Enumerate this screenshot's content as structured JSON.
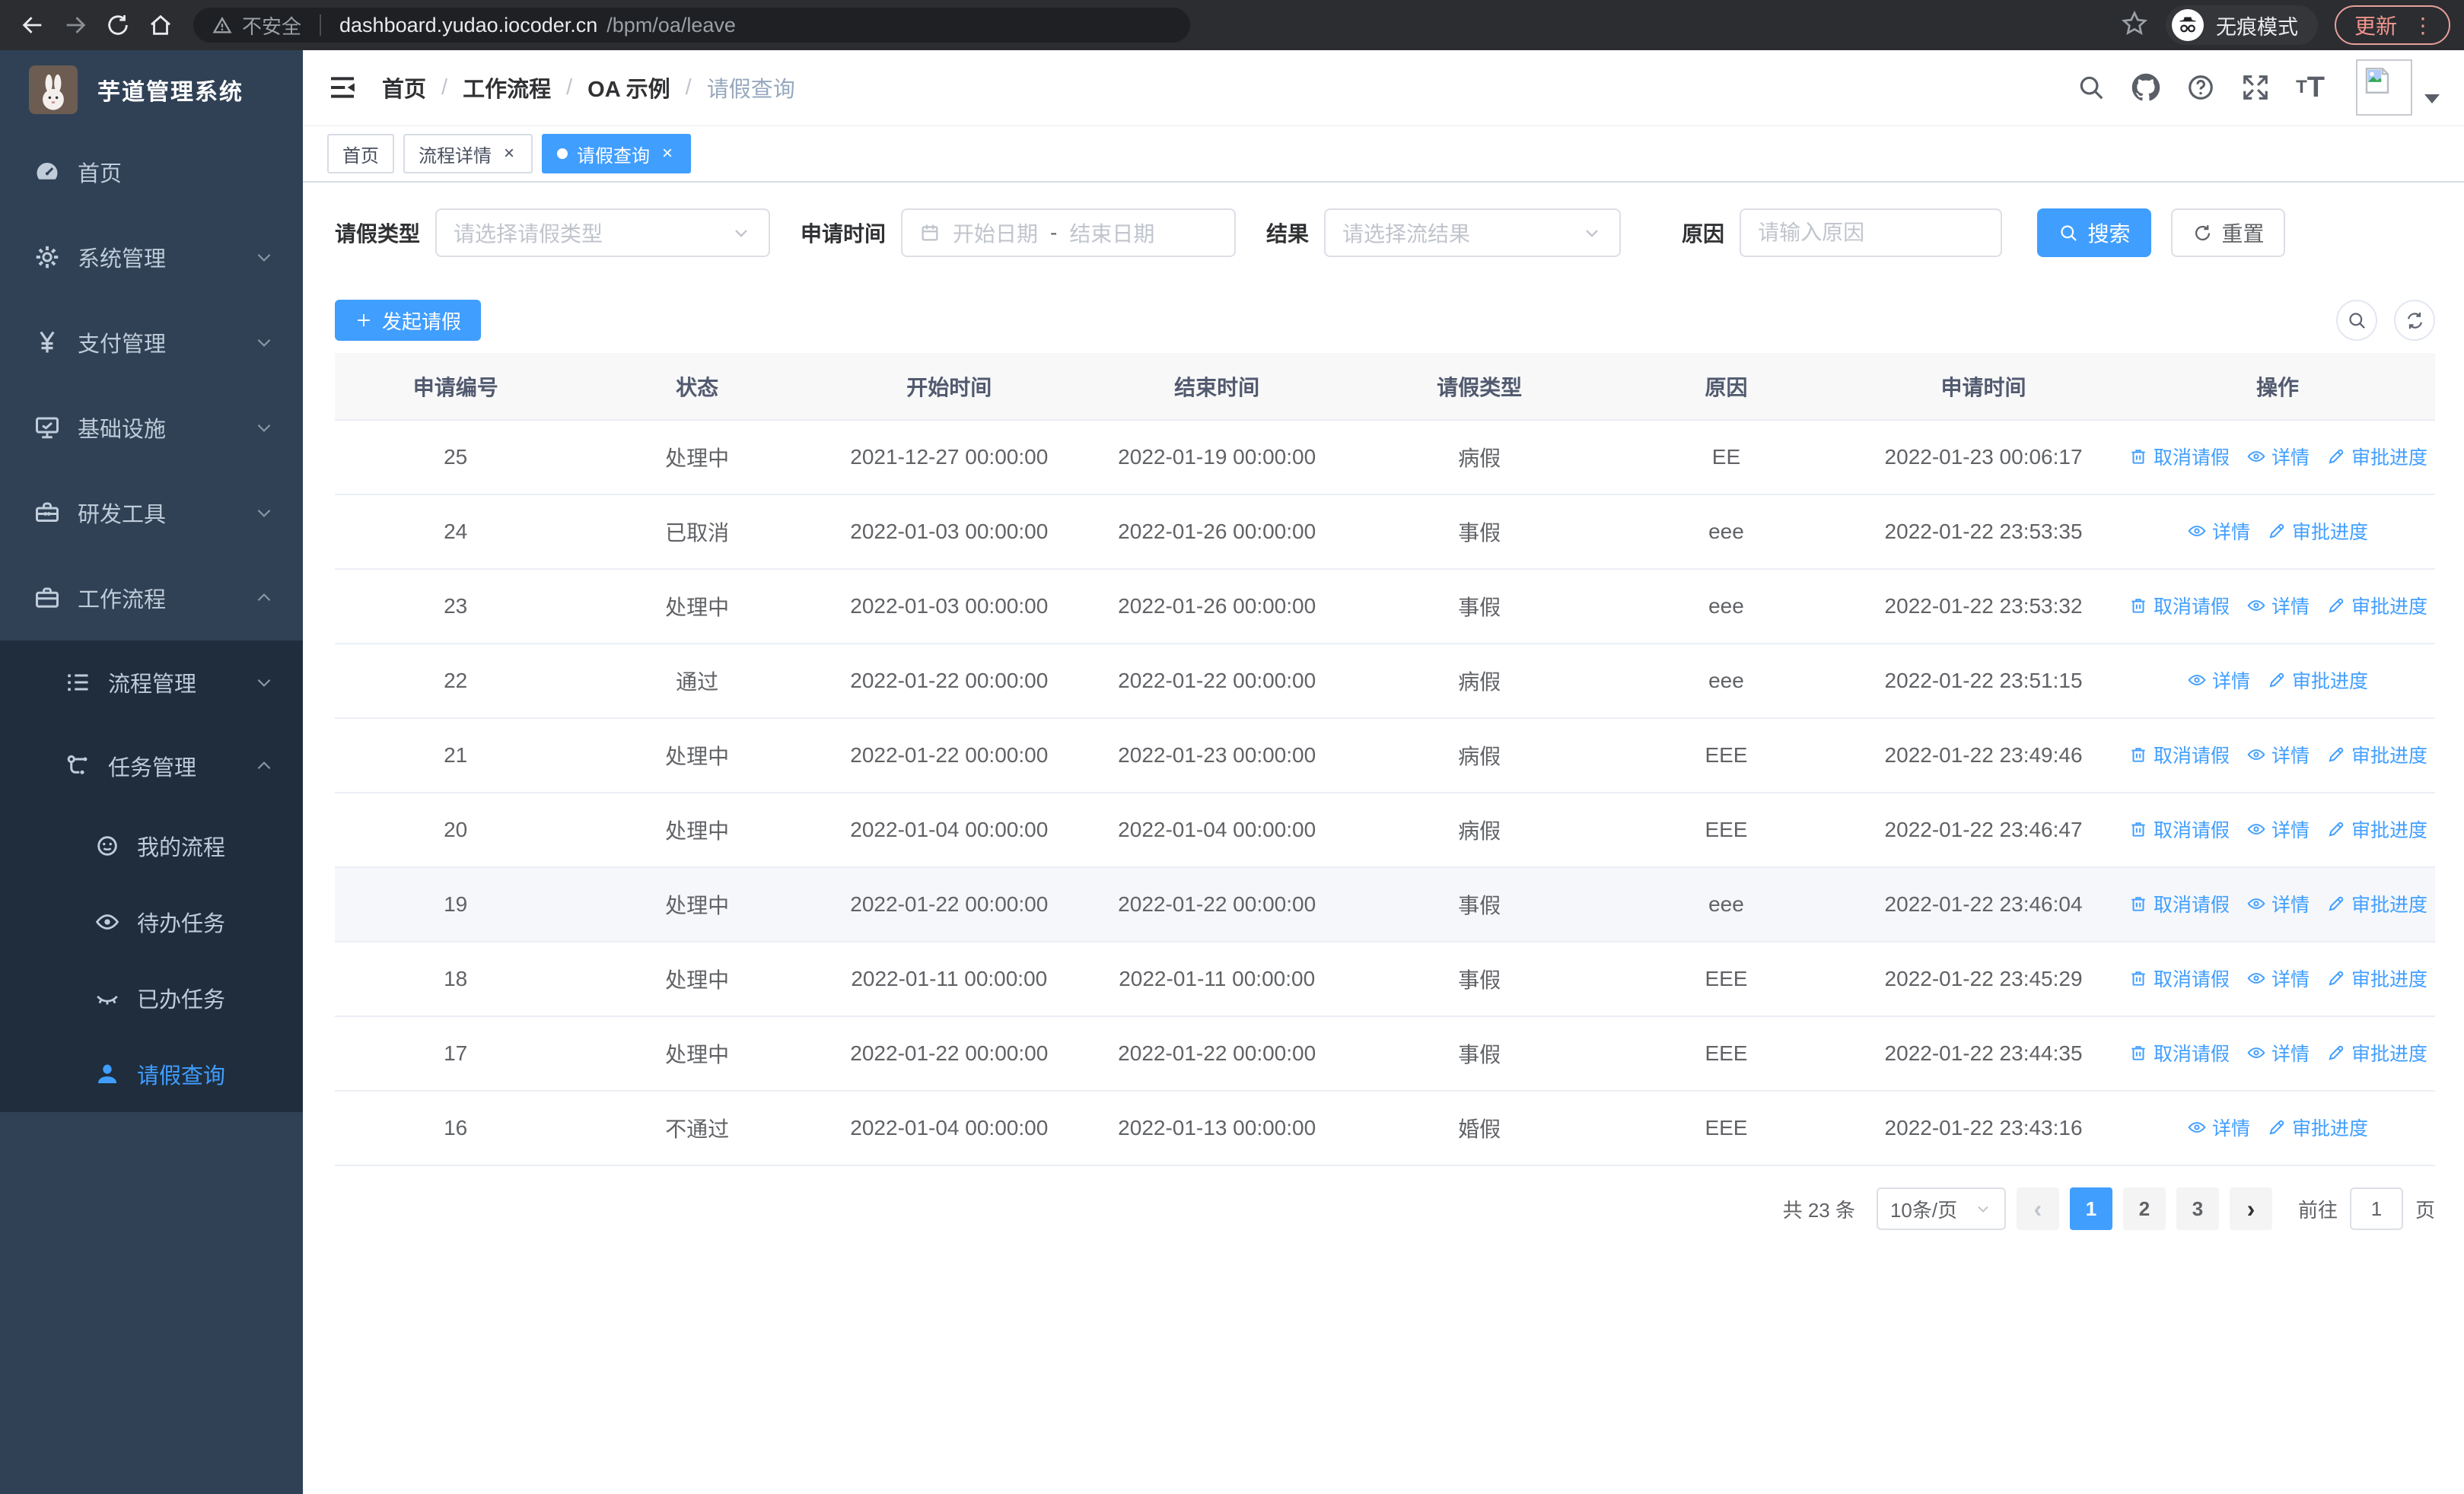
{
  "browser": {
    "security_text": "不安全",
    "url_host": "dashboard.yudao.iocoder.cn",
    "url_path": "/bpm/oa/leave",
    "incognito_label": "无痕模式",
    "update_label": "更新",
    "accent_color": "#f0958c"
  },
  "sidebar": {
    "title": "芋道管理系统",
    "menu": [
      {
        "key": "home",
        "label": "首页",
        "icon": "dashboard-icon",
        "expandable": false,
        "expanded": false
      },
      {
        "key": "system",
        "label": "系统管理",
        "icon": "gear-icon",
        "expandable": true,
        "expanded": false
      },
      {
        "key": "payment",
        "label": "支付管理",
        "icon": "yen-icon",
        "expandable": true,
        "expanded": false
      },
      {
        "key": "infra",
        "label": "基础设施",
        "icon": "monitor-icon",
        "expandable": true,
        "expanded": false
      },
      {
        "key": "dev-tools",
        "label": "研发工具",
        "icon": "toolbox-icon",
        "expandable": true,
        "expanded": false
      },
      {
        "key": "workflow",
        "label": "工作流程",
        "icon": "briefcase-icon",
        "expandable": true,
        "expanded": true
      }
    ],
    "submenu": [
      {
        "key": "process-mgmt",
        "label": "流程管理",
        "icon": "list-icon",
        "expandable": true,
        "expanded": false,
        "children": []
      },
      {
        "key": "task-mgmt",
        "label": "任务管理",
        "icon": "flow-icon",
        "expandable": true,
        "expanded": true,
        "children": [
          {
            "key": "my-process",
            "label": "我的流程",
            "icon": "face-icon",
            "active": false
          },
          {
            "key": "todo-tasks",
            "label": "待办任务",
            "icon": "eye-icon",
            "active": false
          },
          {
            "key": "done-tasks",
            "label": "已办任务",
            "icon": "eye-closed-icon",
            "active": false
          },
          {
            "key": "leave-query",
            "label": "请假查询",
            "icon": "user-icon",
            "active": true
          }
        ]
      }
    ],
    "colors": {
      "bg": "#304156",
      "submenu_bg": "#1f2d3d",
      "text": "#bfcbd9",
      "active": "#409eff"
    }
  },
  "navbar": {
    "breadcrumb": [
      "首页",
      "工作流程",
      "OA 示例",
      "请假查询"
    ]
  },
  "tags": [
    {
      "label": "首页",
      "closable": false,
      "active": false
    },
    {
      "label": "流程详情",
      "closable": true,
      "active": false
    },
    {
      "label": "请假查询",
      "closable": true,
      "active": true
    }
  ],
  "filters": {
    "leave_type_label": "请假类型",
    "leave_type_placeholder": "请选择请假类型",
    "apply_time_label": "申请时间",
    "date_start_placeholder": "开始日期",
    "date_separator": "-",
    "date_end_placeholder": "结束日期",
    "result_label": "结果",
    "result_placeholder": "请选择流结果",
    "reason_label": "原因",
    "reason_placeholder": "请输入原因",
    "search_label": "搜索",
    "reset_label": "重置"
  },
  "toolbar": {
    "create_label": "发起请假"
  },
  "table": {
    "columns": [
      "申请编号",
      "状态",
      "开始时间",
      "结束时间",
      "请假类型",
      "原因",
      "申请时间",
      "操作"
    ],
    "action_labels": {
      "cancel": "取消请假",
      "detail": "详情",
      "progress": "审批进度"
    },
    "rows": [
      {
        "id": "25",
        "status": "处理中",
        "start": "2021-12-27 00:00:00",
        "end": "2022-01-19 00:00:00",
        "type": "病假",
        "reason": "EE",
        "applied": "2022-01-23 00:06:17",
        "actions": [
          "cancel",
          "detail",
          "progress"
        ],
        "highlight": false
      },
      {
        "id": "24",
        "status": "已取消",
        "start": "2022-01-03 00:00:00",
        "end": "2022-01-26 00:00:00",
        "type": "事假",
        "reason": "eee",
        "applied": "2022-01-22 23:53:35",
        "actions": [
          "detail",
          "progress"
        ],
        "highlight": false
      },
      {
        "id": "23",
        "status": "处理中",
        "start": "2022-01-03 00:00:00",
        "end": "2022-01-26 00:00:00",
        "type": "事假",
        "reason": "eee",
        "applied": "2022-01-22 23:53:32",
        "actions": [
          "cancel",
          "detail",
          "progress"
        ],
        "highlight": false
      },
      {
        "id": "22",
        "status": "通过",
        "start": "2022-01-22 00:00:00",
        "end": "2022-01-22 00:00:00",
        "type": "病假",
        "reason": "eee",
        "applied": "2022-01-22 23:51:15",
        "actions": [
          "detail",
          "progress"
        ],
        "highlight": false
      },
      {
        "id": "21",
        "status": "处理中",
        "start": "2022-01-22 00:00:00",
        "end": "2022-01-23 00:00:00",
        "type": "病假",
        "reason": "EEE",
        "applied": "2022-01-22 23:49:46",
        "actions": [
          "cancel",
          "detail",
          "progress"
        ],
        "highlight": false
      },
      {
        "id": "20",
        "status": "处理中",
        "start": "2022-01-04 00:00:00",
        "end": "2022-01-04 00:00:00",
        "type": "病假",
        "reason": "EEE",
        "applied": "2022-01-22 23:46:47",
        "actions": [
          "cancel",
          "detail",
          "progress"
        ],
        "highlight": false
      },
      {
        "id": "19",
        "status": "处理中",
        "start": "2022-01-22 00:00:00",
        "end": "2022-01-22 00:00:00",
        "type": "事假",
        "reason": "eee",
        "applied": "2022-01-22 23:46:04",
        "actions": [
          "cancel",
          "detail",
          "progress"
        ],
        "highlight": true
      },
      {
        "id": "18",
        "status": "处理中",
        "start": "2022-01-11 00:00:00",
        "end": "2022-01-11 00:00:00",
        "type": "事假",
        "reason": "EEE",
        "applied": "2022-01-22 23:45:29",
        "actions": [
          "cancel",
          "detail",
          "progress"
        ],
        "highlight": false
      },
      {
        "id": "17",
        "status": "处理中",
        "start": "2022-01-22 00:00:00",
        "end": "2022-01-22 00:00:00",
        "type": "事假",
        "reason": "EEE",
        "applied": "2022-01-22 23:44:35",
        "actions": [
          "cancel",
          "detail",
          "progress"
        ],
        "highlight": false
      },
      {
        "id": "16",
        "status": "不通过",
        "start": "2022-01-04 00:00:00",
        "end": "2022-01-13 00:00:00",
        "type": "婚假",
        "reason": "EEE",
        "applied": "2022-01-22 23:43:16",
        "actions": [
          "detail",
          "progress"
        ],
        "highlight": false
      }
    ]
  },
  "pagination": {
    "total": "共 23 条",
    "page_size": "10条/页",
    "prev": "‹",
    "next": "›",
    "pages": [
      "1",
      "2",
      "3"
    ],
    "active_page": "1",
    "goto_label": "前往",
    "goto_value": "1",
    "unit_label": "页"
  },
  "theme": {
    "primary": "#409eff"
  }
}
